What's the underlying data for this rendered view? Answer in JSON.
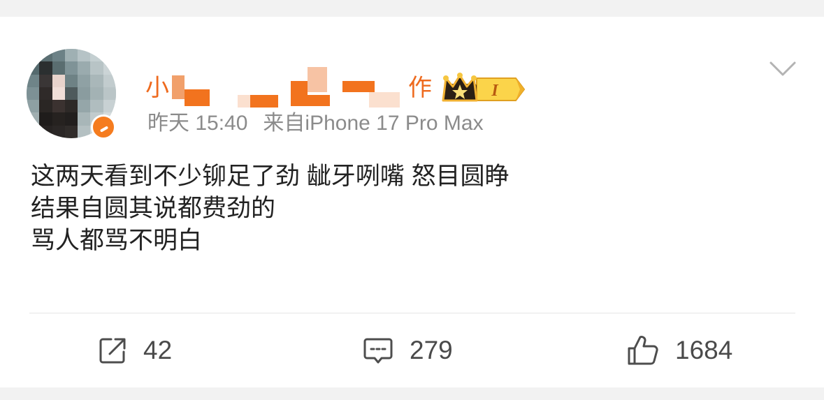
{
  "post": {
    "author": {
      "name_visible_prefix": "小",
      "name_visible_suffix": "作",
      "level_badge": "I"
    },
    "meta": {
      "time": "昨天 15:40",
      "source": "来自iPhone 17 Pro Max"
    },
    "body_lines": [
      "这两天看到不少铆足了劲 龇牙咧嘴 怒目圆睁",
      "结果自圆其说都费劲的",
      "骂人都骂不明白"
    ],
    "actions": {
      "repost_count": "42",
      "comment_count": "279",
      "like_count": "1684"
    }
  },
  "colors": {
    "name_orange": "#ee6a1e",
    "meta_gray": "#8b8b8b",
    "text": "#222222",
    "badge_gold": "#f7c63c",
    "background": "#f2f2f2"
  },
  "icons": {
    "repost": "share-square-arrow-icon",
    "comment": "comment-bubble-icon",
    "like": "thumbs-up-icon",
    "more": "chevron-down-icon",
    "vip": "vip-badge-icon",
    "crown": "crown-level-badge-icon"
  }
}
